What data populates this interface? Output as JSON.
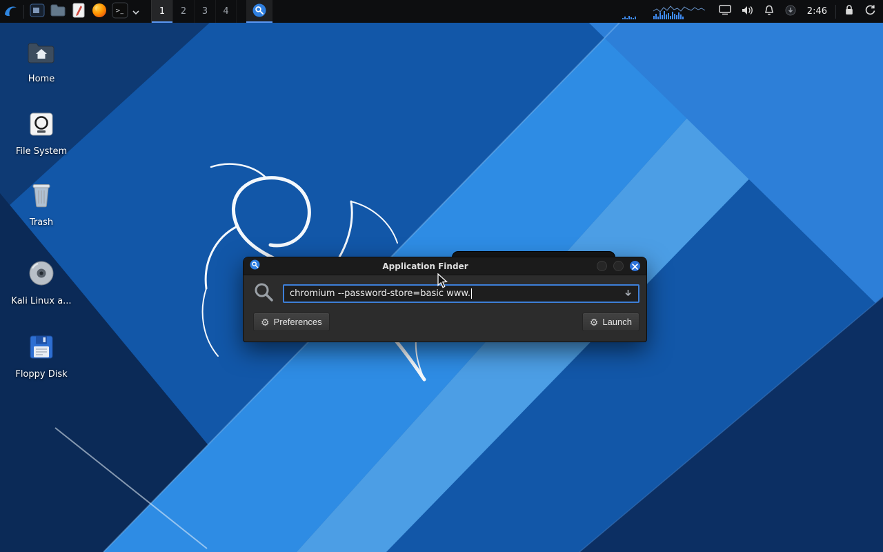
{
  "panel": {
    "workspaces": [
      "1",
      "2",
      "3",
      "4"
    ],
    "active_workspace": "1",
    "terminal_glyph": ">_",
    "clock": "2:46",
    "left_icons": [
      "kali-menu",
      "app-window",
      "file-manager",
      "text-editor",
      "firefox",
      "terminal",
      "terminal-dropdown"
    ],
    "task_button": "application-finder",
    "tray_icons": [
      "display",
      "volume",
      "notifications",
      "status",
      "lock",
      "session"
    ]
  },
  "desktop": {
    "icons": [
      {
        "label": "Home"
      },
      {
        "label": "File System"
      },
      {
        "label": "Trash"
      },
      {
        "label": "Kali Linux a..."
      },
      {
        "label": "Floppy Disk"
      }
    ]
  },
  "app_finder": {
    "title": "Application Finder",
    "search_value": "chromium --password-store=basic www.",
    "preferences_label": "Preferences",
    "launch_label": "Launch"
  },
  "icons": {
    "gear": "⚙"
  },
  "colors": {
    "accent_blue": "#3d7fd8",
    "close_button_blue": "#2d72d9",
    "panel_background": "#0d0e10",
    "active_underline": "#5b97f2"
  }
}
